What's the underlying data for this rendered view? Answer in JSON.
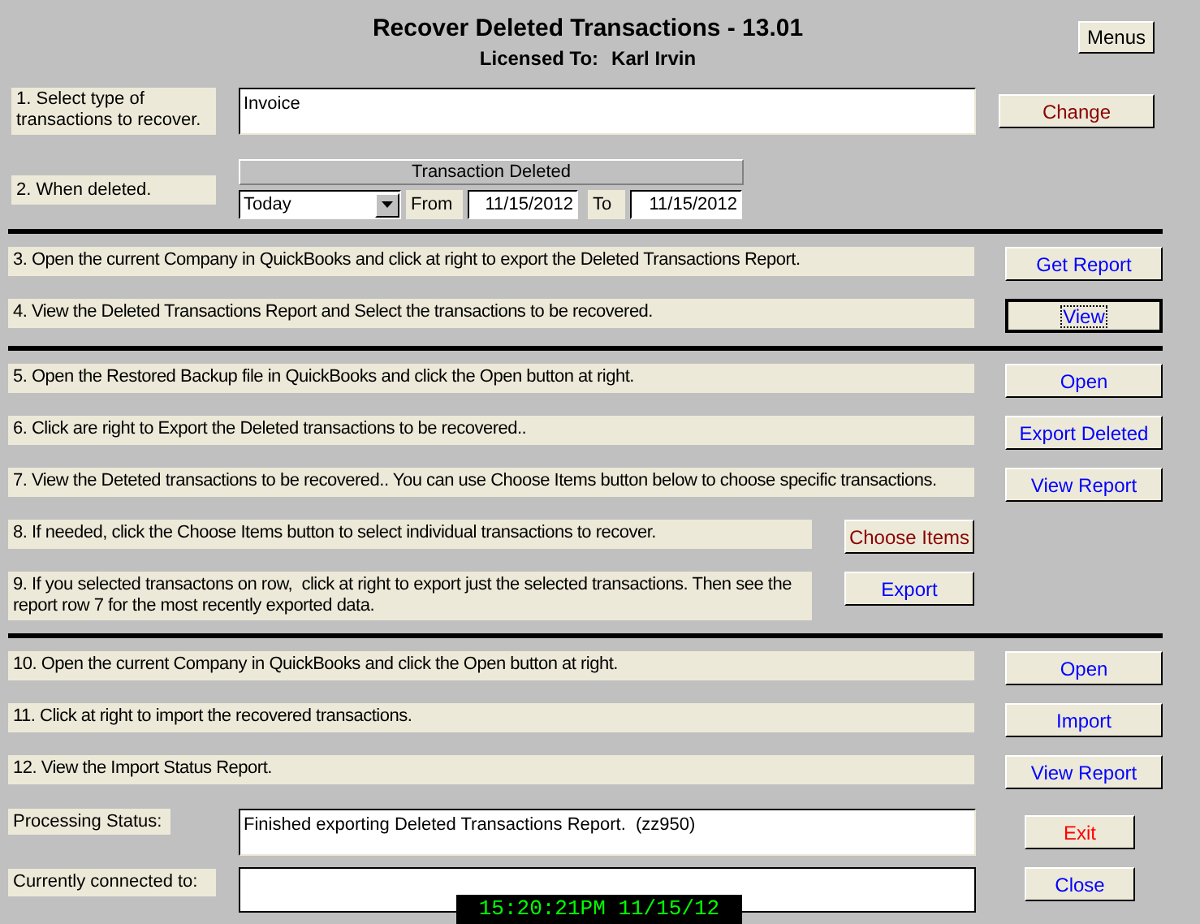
{
  "title": "Recover Deleted Transactions - 13.01",
  "license": {
    "label": "Licensed To:",
    "name": "Karl Irvin"
  },
  "menus_button": {
    "label": "Menus"
  },
  "step1": {
    "label": "1. Select type of transactions to recover.",
    "value": "Invoice",
    "button": {
      "label": "Change",
      "color": "#8b0000",
      "focused": false
    }
  },
  "step2": {
    "label": "2. When deleted.",
    "group_title": "Transaction Deleted",
    "period": "Today",
    "from_label": "From",
    "from": "11/15/2012",
    "to_label": "To",
    "to": "11/15/2012"
  },
  "sections": [
    [
      {
        "kind": "wide",
        "text": "3. Open the current Company in QuickBooks and click at right to export the Deleted Transactions Report.",
        "button": {
          "label": "Get Report",
          "color": "#0000ff",
          "focused": false
        }
      },
      {
        "kind": "wide",
        "text": "4. View the Deleted Transactions Report and Select the transactions to be recovered.",
        "button": {
          "label": "View",
          "color": "#0000ff",
          "focused": true
        }
      }
    ],
    [
      {
        "kind": "wide",
        "text": "5. Open the Restored Backup file in QuickBooks and click the Open button at right.",
        "button": {
          "label": "Open",
          "color": "#0000ff",
          "focused": false
        }
      },
      {
        "kind": "wide",
        "text": "6. Click are right to Export the Deleted transactions to be recovered..",
        "button": {
          "label": "Export Deleted",
          "color": "#0000ff",
          "focused": false
        }
      },
      {
        "kind": "wide",
        "text": "7. View the Deteted transactions to be recovered.. You can use Choose Items button below to choose specific transactions.",
        "button": {
          "label": "View Report",
          "color": "#0000ff",
          "focused": false
        }
      },
      {
        "kind": "narrow",
        "text": "8. If needed, click the Choose Items button to select individual transactions to recover.",
        "button": {
          "label": "Choose Items",
          "color": "#8b0000",
          "focused": false
        }
      },
      {
        "kind": "narrow",
        "text": "9. If you selected transactons on row,  click at right to export just the selected transactions. Then see the report row 7 for the most recently exported data.",
        "button": {
          "label": "Export",
          "color": "#0000ff",
          "focused": false
        }
      }
    ],
    [
      {
        "kind": "wide",
        "text": "10. Open the current Company in QuickBooks and click the Open button at right.",
        "button": {
          "label": "Open",
          "color": "#0000ff",
          "focused": false
        }
      },
      {
        "kind": "wide",
        "text": "11. Click at right to import the recovered transactions.",
        "button": {
          "label": "Import",
          "color": "#0000ff",
          "focused": false
        }
      },
      {
        "kind": "wide",
        "text": "12. View the Import Status Report.",
        "button": {
          "label": "View Report",
          "color": "#0000ff",
          "focused": false
        }
      }
    ]
  ],
  "status": {
    "label": "Processing Status:",
    "value": "Finished exporting Deleted Transactions Report.  (zz950)",
    "button": {
      "label": "Exit",
      "color": "#ff0000",
      "focused": false
    }
  },
  "connection": {
    "label": "Currently connected to:",
    "button": {
      "label": "Close",
      "color": "#0000ff",
      "focused": false
    }
  },
  "clock": "15:20:21PM 11/15/12"
}
